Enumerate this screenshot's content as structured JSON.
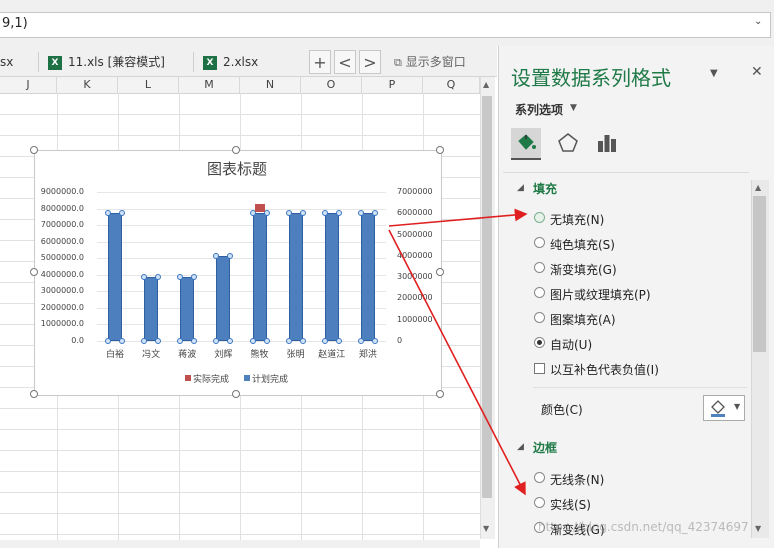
{
  "formula_bar": {
    "text": "9,1)"
  },
  "workbook_tabs": [
    {
      "label": "sx"
    },
    {
      "label": "11.xls  [兼容模式]"
    },
    {
      "label": "2.xlsx"
    }
  ],
  "tab_controls": {
    "add": "+",
    "prev": "<",
    "next": ">",
    "multi_window_label": "显示多窗口"
  },
  "columns": [
    "J",
    "K",
    "L",
    "M",
    "N",
    "O",
    "P",
    "Q"
  ],
  "chart_data": {
    "type": "bar",
    "title": "图表标题",
    "categories": [
      "白裕",
      "冯文",
      "蒋波",
      "刘辉",
      "熊牧",
      "张明",
      "赵道江",
      "郑洪"
    ],
    "left_axis_ticks": [
      "9000000.0",
      "8000000.0",
      "7000000.0",
      "6000000.0",
      "5000000.0",
      "4000000.0",
      "3000000.0",
      "2000000.0",
      "1000000.0",
      "0.0"
    ],
    "right_axis_ticks": [
      "7000000",
      "6000000",
      "5000000",
      "4000000",
      "3000000",
      "2000000",
      "1000000",
      "0"
    ],
    "ylim_left": [
      0,
      9000000
    ],
    "ylim_right": [
      0,
      7000000
    ],
    "series": [
      {
        "name": "实际完成",
        "color": "#c0504d",
        "values": [
          null,
          null,
          null,
          null,
          8100000,
          null,
          null,
          null
        ]
      },
      {
        "name": "计划完成",
        "color": "#4f81bd",
        "values": [
          6000000,
          3000000,
          3000000,
          4000000,
          6000000,
          6000000,
          6000000,
          6000000
        ]
      }
    ],
    "legend_position": "bottom"
  },
  "pane": {
    "title": "设置数据系列格式",
    "dropdown_glyph": "▼",
    "close_glyph": "✕",
    "series_options_label": "系列选项",
    "icons": [
      "fill-bucket-icon",
      "pentagon-icon",
      "bar-chart-icon"
    ],
    "fill_section": {
      "title": "填充",
      "options": [
        {
          "label": "无填充(N)",
          "checked": false
        },
        {
          "label": "纯色填充(S)",
          "checked": false
        },
        {
          "label": "渐变填充(G)",
          "checked": false
        },
        {
          "label": "图片或纹理填充(P)",
          "checked": false
        },
        {
          "label": "图案填充(A)",
          "checked": false
        },
        {
          "label": "自动(U)",
          "checked": true
        }
      ],
      "invert_label": "以互补色代表负值(I)",
      "color_label": "颜色(C)"
    },
    "border_section": {
      "title": "边框",
      "options": [
        {
          "label": "无线条(N)"
        },
        {
          "label": "实线(S)"
        },
        {
          "label": "渐变线(G)"
        }
      ]
    }
  },
  "watermark": "https://blog.csdn.net/qq_42374697"
}
